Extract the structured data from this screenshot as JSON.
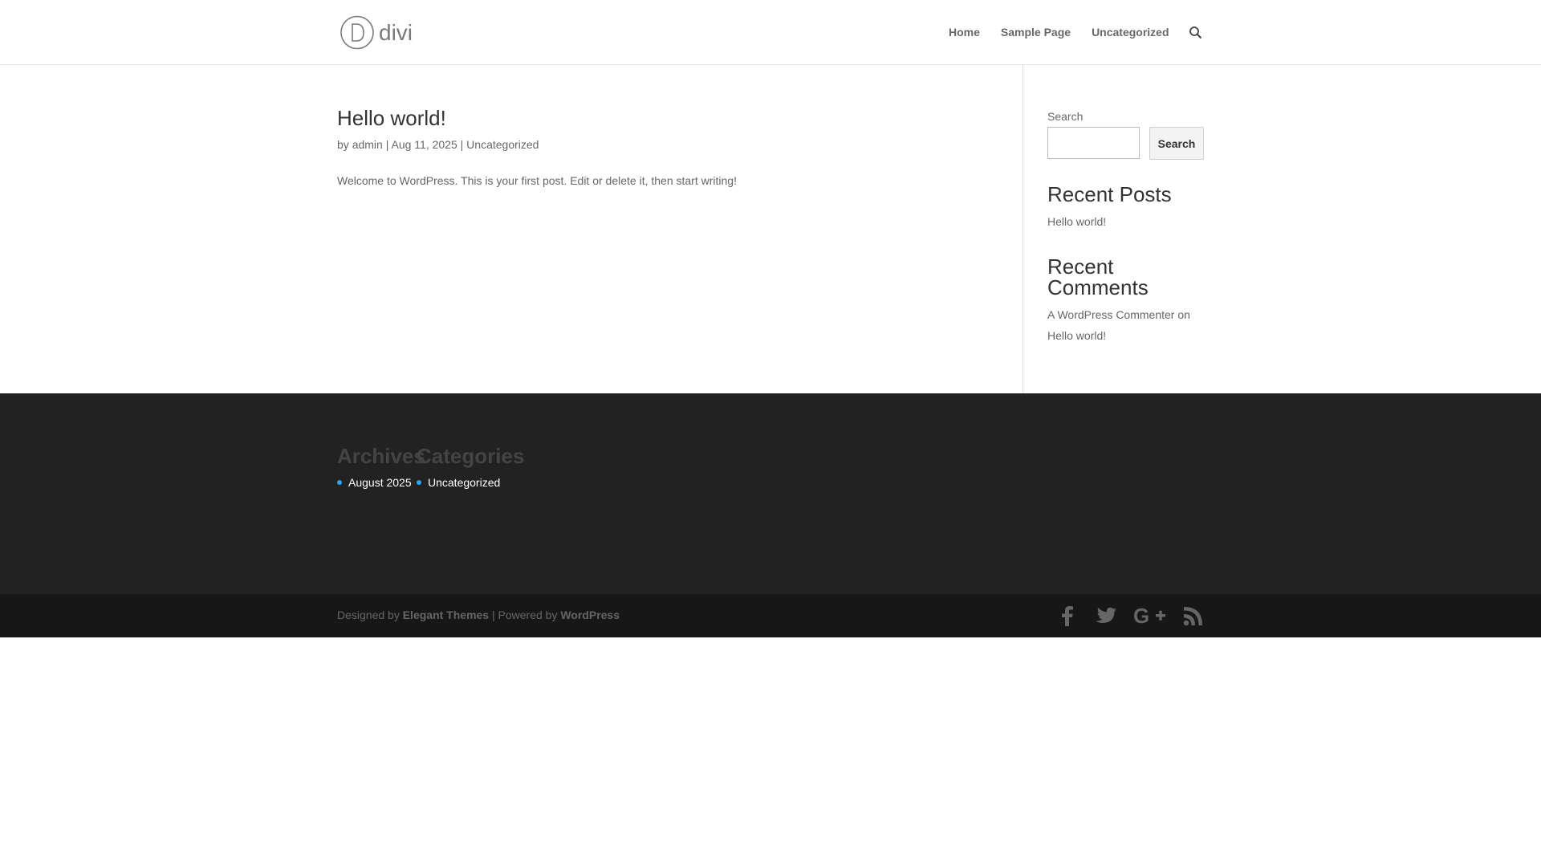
{
  "header": {
    "logo_text": "divi",
    "menu": [
      {
        "label": "Home"
      },
      {
        "label": "Sample Page"
      },
      {
        "label": "Uncategorized"
      }
    ]
  },
  "post": {
    "title": "Hello world!",
    "meta": {
      "by": "by",
      "author": "admin",
      "sep1": "|",
      "date": "Aug 11, 2025",
      "sep2": "|",
      "category": "Uncategorized"
    },
    "excerpt": "Welcome to WordPress. This is your first post. Edit or delete it, then start writing!"
  },
  "sidebar": {
    "search_label": "Search",
    "search_value": "",
    "search_button": "Search",
    "recent_posts_title": "Recent Posts",
    "recent_posts": [
      "Hello world!"
    ],
    "recent_comments_title_line1": "Recent",
    "recent_comments_title_line2": "Comments",
    "recent_comment": {
      "author": "A WordPress Commenter",
      "on": "on",
      "post": "Hello world!"
    }
  },
  "footer_widgets": {
    "archives_title": "Archives",
    "categories_title": "Categories",
    "archives_item": "August 2025",
    "categories_item": "Uncategorized"
  },
  "footer_bottom": {
    "designed_by": "Designed by",
    "elegant_themes": "Elegant Themes",
    "powered_by": "| Powered by",
    "wordpress": "WordPress",
    "social_icons": [
      "facebook-icon",
      "twitter-icon",
      "google-plus-icon",
      "rss-icon"
    ]
  },
  "colors": {
    "accent": "#2ea3f2",
    "footer_widgets_bg": "#222222",
    "footer_bottom_bg": "#171717"
  }
}
